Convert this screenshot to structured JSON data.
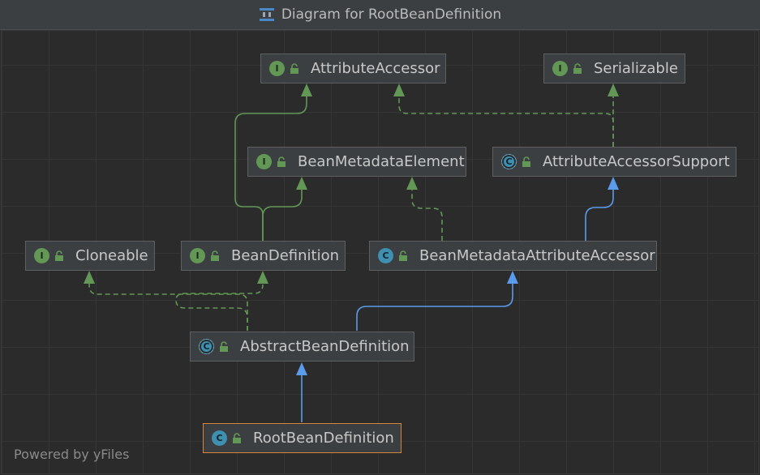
{
  "window": {
    "title": "Diagram for RootBeanDefinition"
  },
  "footer": {
    "text": "Powered by yFiles"
  },
  "nodes": {
    "attribute_accessor": {
      "label": "AttributeAccessor",
      "kind": "I"
    },
    "serializable": {
      "label": "Serializable",
      "kind": "I"
    },
    "bean_metadata_element": {
      "label": "BeanMetadataElement",
      "kind": "I"
    },
    "attribute_accessor_support": {
      "label": "AttributeAccessorSupport",
      "kind": "C"
    },
    "cloneable": {
      "label": "Cloneable",
      "kind": "I"
    },
    "bean_definition": {
      "label": "BeanDefinition",
      "kind": "I"
    },
    "bean_metadata_attribute_accessor": {
      "label": "BeanMetadataAttributeAccessor",
      "kind": "C"
    },
    "abstract_bean_definition": {
      "label": "AbstractBeanDefinition",
      "kind": "C"
    },
    "root_bean_definition": {
      "label": "RootBeanDefinition",
      "kind": "C"
    }
  },
  "colors": {
    "interface_extends": "#629755",
    "implements": "#629755",
    "class_extends": "#5a9bec",
    "selected_border": "#d5853c"
  }
}
